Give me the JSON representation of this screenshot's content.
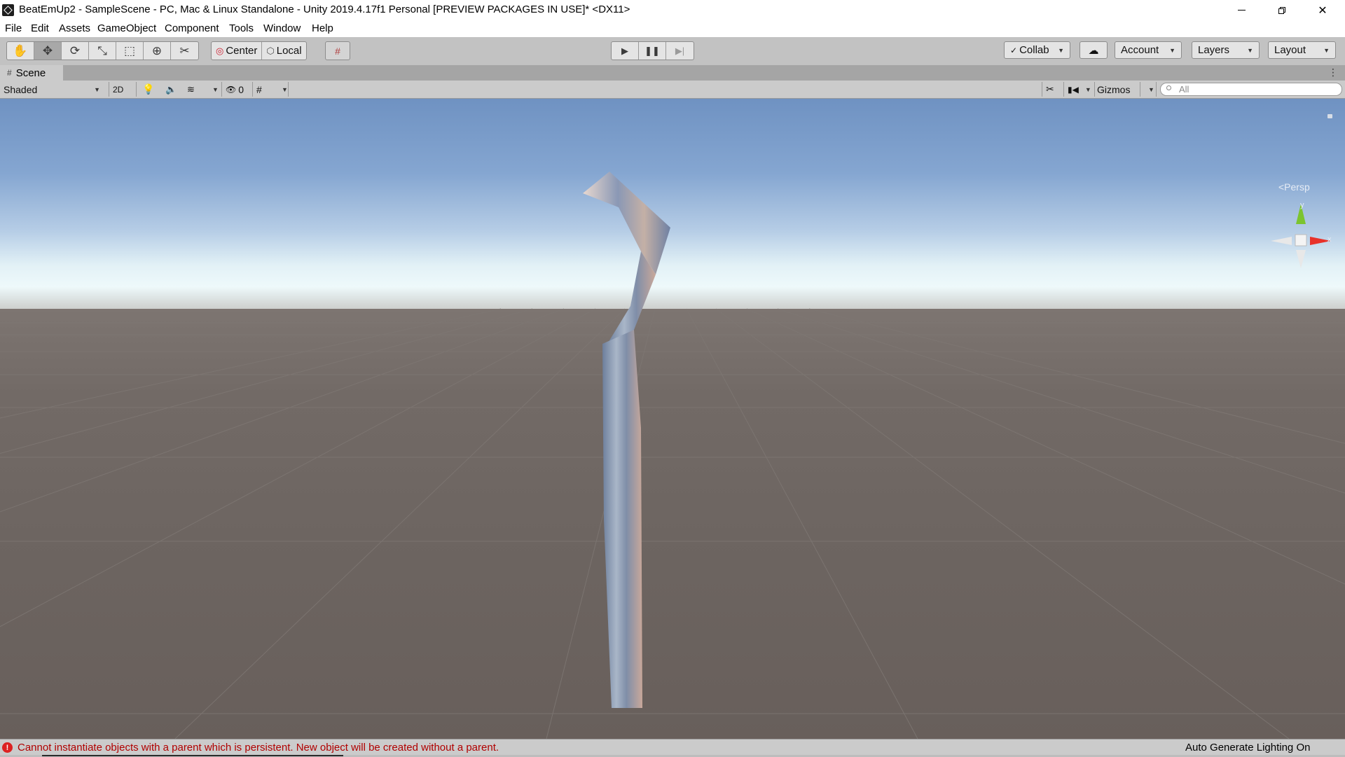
{
  "window": {
    "title": "BeatEmUp2 - SampleScene - PC, Mac & Linux Standalone - Unity 2019.4.17f1 Personal [PREVIEW PACKAGES IN USE]* <DX11>",
    "minimize_glyph": "—",
    "close_glyph": "✕"
  },
  "menu": [
    "File",
    "Edit",
    "Assets",
    "GameObject",
    "Component",
    "Tools",
    "Window",
    "Help"
  ],
  "toolbar": {
    "tools": [
      {
        "name": "hand-tool",
        "icon": "hand-icon",
        "glyph": "✋",
        "active": false
      },
      {
        "name": "move-tool",
        "icon": "move-icon",
        "glyph": "✥",
        "active": true
      },
      {
        "name": "rotate-tool",
        "icon": "rotate-icon",
        "glyph": "⟳",
        "active": false
      },
      {
        "name": "scale-tool",
        "icon": "scale-icon",
        "glyph": "⤡",
        "active": false
      },
      {
        "name": "rect-tool",
        "icon": "rect-icon",
        "glyph": "⬚",
        "active": false
      },
      {
        "name": "transform-tool",
        "icon": "transform-icon",
        "glyph": "⊕",
        "active": false
      },
      {
        "name": "custom-tool",
        "icon": "wrench-icon",
        "glyph": "✂",
        "active": false
      }
    ],
    "pivot_label": "Center",
    "space_label": "Local",
    "collab_label": "Collab",
    "account_label": "Account",
    "layers_label": "Layers",
    "layout_label": "Layout"
  },
  "scene_panel": {
    "tab_label": "Scene",
    "shading_mode": "Shaded",
    "mode_2d": "2D",
    "hidden_count": "0",
    "gizmos_label": "Gizmos",
    "search_placeholder": "All",
    "persp_label": "<Persp",
    "axis_y": "y",
    "axis_x": "x"
  },
  "status": {
    "error_icon": "!",
    "error_message": "Cannot instantiate objects with a parent which is persistent. New object will be created without a parent.",
    "lighting": "Auto Generate Lighting On"
  },
  "colors": {
    "error": "#b00000",
    "gizmo_x": "#e8322a",
    "gizmo_y": "#7cc42f",
    "gizmo_neutral": "#e8e8e8"
  }
}
